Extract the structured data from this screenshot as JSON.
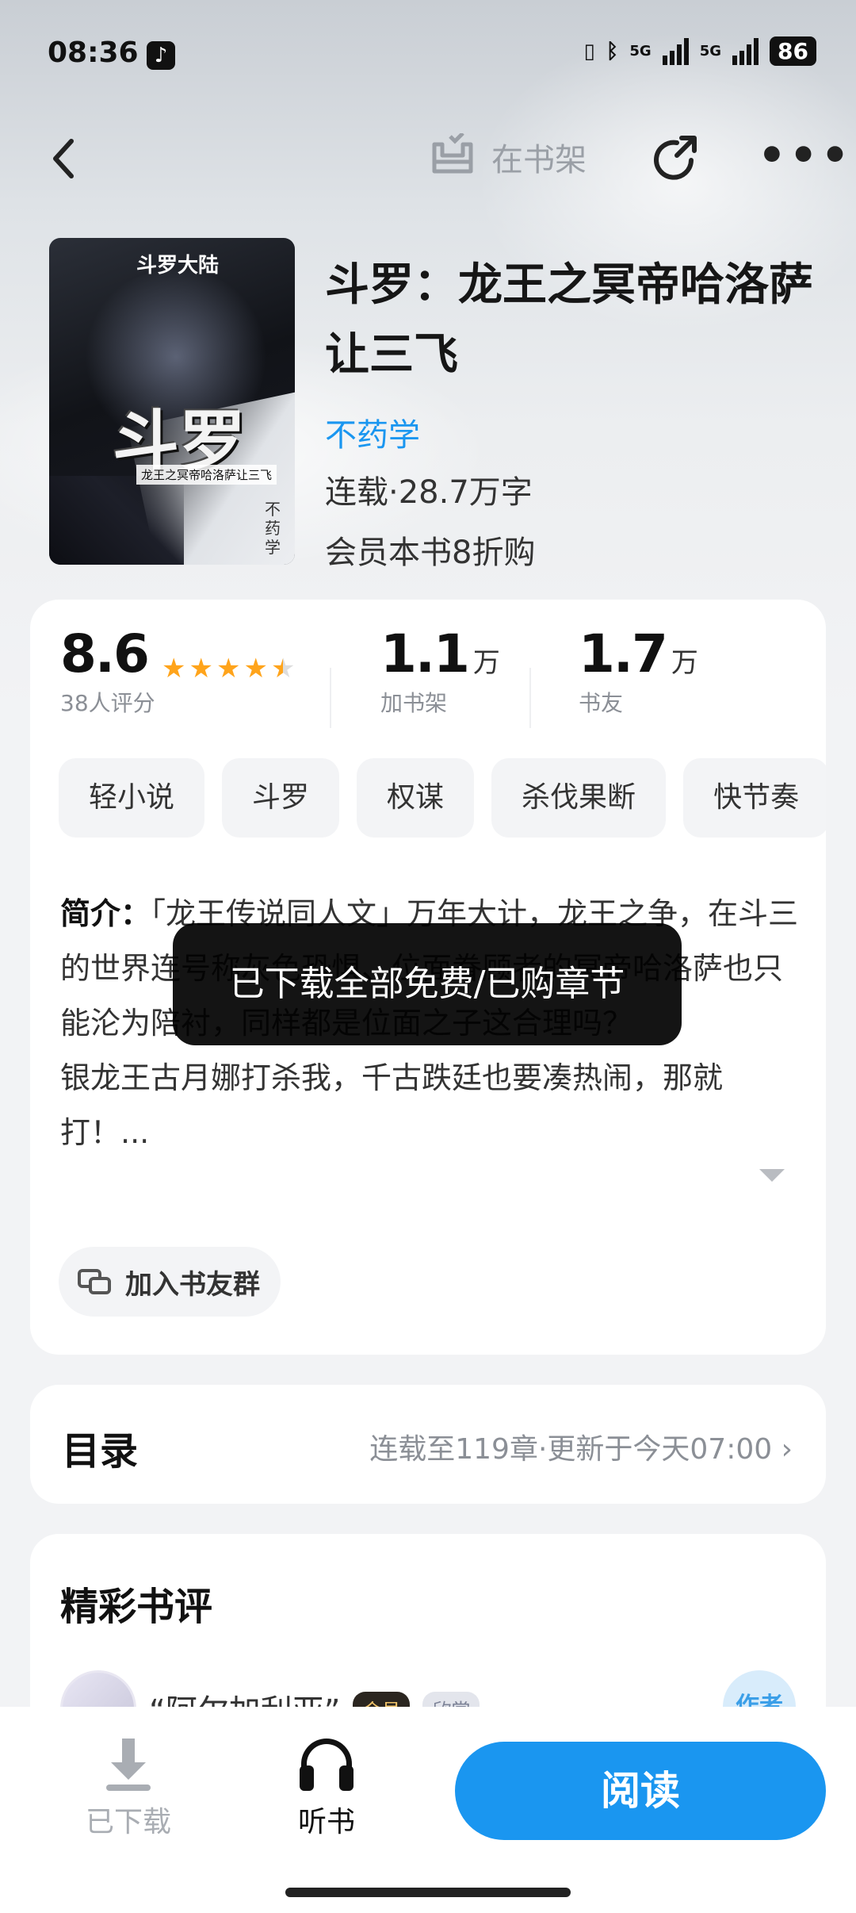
{
  "status_bar": {
    "time": "08:36",
    "battery": "86",
    "net1": "5G",
    "net2": "5G"
  },
  "nav": {
    "back_icon": "chevron-left-icon",
    "shelf_label": "在书架",
    "share_icon": "share-icon",
    "more_icon": "more-icon"
  },
  "book": {
    "title": "斗罗：龙王之冥帝哈洛萨让三飞",
    "author": "不药学",
    "meta": "连载·28.7万字",
    "vip_offer": "会员本书8折购",
    "cover": {
      "series": "斗罗大陆",
      "big": "斗罗",
      "subtitle": "龙王之冥帝哈洛萨让三飞",
      "author_vertical": "不药学"
    }
  },
  "stats": {
    "rating": "8.6",
    "rating_count": "38人评分",
    "rating_stars": 4.5,
    "shelf_num": "1.1",
    "shelf_unit": "万",
    "shelf_label": "加书架",
    "friends_num": "1.7",
    "friends_unit": "万",
    "friends_label": "书友"
  },
  "tags": [
    "轻小说",
    "斗罗",
    "权谋",
    "杀伐果断",
    "快节奏"
  ],
  "intro": {
    "label": "简介：",
    "text": "「龙王传说同人文」万年大计，龙王之争，在斗三的世界连号称灰色恐惧、位面眷顾者的冥帝哈洛萨也只能沦为陪衬，同样都是位面之子这合理吗？",
    "text2": "银龙王古月娜打杀我，千古跌廷也要凑热闹，那就打！..."
  },
  "group_button": "加入书友群",
  "toc": {
    "title": "目录",
    "info": "连载至119章·更新于今天07:00 ›"
  },
  "reviews": {
    "title": "精彩书评",
    "user": "“阿尔加利亚”",
    "badge_vip": "会员",
    "badge_app": "欣赏",
    "author_badge": "作者"
  },
  "toast": "已下载全部免费/已购章节",
  "bottom": {
    "downloaded": "已下载",
    "listen": "听书",
    "read": "阅读"
  }
}
